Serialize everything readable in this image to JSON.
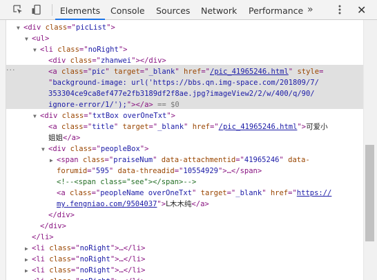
{
  "toolbar": {
    "tabs": [
      "Elements",
      "Console",
      "Sources",
      "Network",
      "Performance"
    ],
    "more_label": "»",
    "close_label": "✕"
  },
  "tree": {
    "lines": [
      {
        "indent": 1,
        "tri": "▼",
        "parts": [
          [
            "tag",
            "<div "
          ],
          [
            "an",
            "class"
          ],
          [
            "tag",
            "=\""
          ],
          [
            "av",
            "picList"
          ],
          [
            "tag",
            "\">"
          ]
        ]
      },
      {
        "indent": 2,
        "tri": "▼",
        "parts": [
          [
            "tag",
            "<ul>"
          ]
        ]
      },
      {
        "indent": 3,
        "tri": "▼",
        "parts": [
          [
            "tag",
            "<li "
          ],
          [
            "an",
            "class"
          ],
          [
            "tag",
            "=\""
          ],
          [
            "av",
            "noRight"
          ],
          [
            "tag",
            "\">"
          ]
        ]
      },
      {
        "indent": 4,
        "tri": "",
        "parts": [
          [
            "tag",
            "<div "
          ],
          [
            "an",
            "class"
          ],
          [
            "tag",
            "=\""
          ],
          [
            "av",
            "zhanwei"
          ],
          [
            "tag",
            "\"></div>"
          ]
        ]
      },
      {
        "indent": 4,
        "tri": "",
        "parts": [
          [
            "tag",
            "<a "
          ],
          [
            "an",
            "class"
          ],
          [
            "tag",
            "=\""
          ],
          [
            "av",
            "pic"
          ],
          [
            "tag",
            "\" "
          ],
          [
            "an",
            "target"
          ],
          [
            "tag",
            "=\""
          ],
          [
            "av",
            "_blank"
          ],
          [
            "tag",
            "\" "
          ],
          [
            "an",
            "href"
          ],
          [
            "tag",
            "=\""
          ],
          [
            "lnk",
            "/pic_41965246.html"
          ],
          [
            "tag",
            "\" "
          ],
          [
            "an",
            "style"
          ],
          [
            "tag",
            "="
          ]
        ]
      },
      {
        "indent": 4,
        "tri": "",
        "parts": [
          [
            "tag",
            "\""
          ],
          [
            "av",
            "background-image: url('https://bbs.qn.img-space.com/201809/7/"
          ]
        ]
      },
      {
        "indent": 4,
        "tri": "",
        "parts": [
          [
            "av",
            "353304ce9ca8ef477e2fb3189df2f8ae.jpg?imageView2/2/w/400/q/90/"
          ]
        ]
      },
      {
        "indent": 4,
        "tri": "",
        "parts": [
          [
            "av",
            "ignore-error/1/');"
          ],
          [
            "tag",
            "\"></a>"
          ],
          [
            "eq",
            " == $0"
          ]
        ]
      },
      {
        "indent": 3,
        "tri": "▼",
        "parts": [
          [
            "tag",
            "<div "
          ],
          [
            "an",
            "class"
          ],
          [
            "tag",
            "=\""
          ],
          [
            "av",
            "txtBox overOneTxt"
          ],
          [
            "tag",
            "\">"
          ]
        ]
      },
      {
        "indent": 4,
        "tri": "",
        "parts": [
          [
            "tag",
            "<a "
          ],
          [
            "an",
            "class"
          ],
          [
            "tag",
            "=\""
          ],
          [
            "av",
            "title"
          ],
          [
            "tag",
            "\" "
          ],
          [
            "an",
            "target"
          ],
          [
            "tag",
            "=\""
          ],
          [
            "av",
            "_blank"
          ],
          [
            "tag",
            "\" "
          ],
          [
            "an",
            "href"
          ],
          [
            "tag",
            "=\""
          ],
          [
            "lnk",
            "/pic_41965246.html"
          ],
          [
            "tag",
            "\">"
          ],
          [
            "txt",
            "可爱小"
          ]
        ]
      },
      {
        "indent": 4,
        "tri": "",
        "parts": [
          [
            "txt",
            "姐姐"
          ],
          [
            "tag",
            "</a>"
          ]
        ]
      },
      {
        "indent": 4,
        "tri": "▼",
        "parts": [
          [
            "tag",
            "<div "
          ],
          [
            "an",
            "class"
          ],
          [
            "tag",
            "=\""
          ],
          [
            "av",
            "peopleBox"
          ],
          [
            "tag",
            "\">"
          ]
        ]
      },
      {
        "indent": 5,
        "tri": "▶",
        "parts": [
          [
            "tag",
            "<span "
          ],
          [
            "an",
            "class"
          ],
          [
            "tag",
            "=\""
          ],
          [
            "av",
            "praiseNum"
          ],
          [
            "tag",
            "\" "
          ],
          [
            "an",
            "data-attachmentid"
          ],
          [
            "tag",
            "=\""
          ],
          [
            "av",
            "41965246"
          ],
          [
            "tag",
            "\" "
          ],
          [
            "an",
            "data-"
          ]
        ]
      },
      {
        "indent": 5,
        "tri": "",
        "parts": [
          [
            "an",
            "forumid"
          ],
          [
            "tag",
            "=\""
          ],
          [
            "av",
            "595"
          ],
          [
            "tag",
            "\" "
          ],
          [
            "an",
            "data-threadid"
          ],
          [
            "tag",
            "=\""
          ],
          [
            "av",
            "10554929"
          ],
          [
            "tag",
            "\">…</span>"
          ]
        ]
      },
      {
        "indent": 5,
        "tri": "",
        "parts": [
          [
            "cm",
            "<!--<span class=\"see\"></span>-->"
          ]
        ]
      },
      {
        "indent": 5,
        "tri": "",
        "parts": [
          [
            "tag",
            "<a "
          ],
          [
            "an",
            "class"
          ],
          [
            "tag",
            "=\""
          ],
          [
            "av",
            "peopleName overOneTxt"
          ],
          [
            "tag",
            "\" "
          ],
          [
            "an",
            "target"
          ],
          [
            "tag",
            "=\""
          ],
          [
            "av",
            "_blank"
          ],
          [
            "tag",
            "\" "
          ],
          [
            "an",
            "href"
          ],
          [
            "tag",
            "=\""
          ],
          [
            "lnk",
            "https://"
          ]
        ]
      },
      {
        "indent": 5,
        "tri": "",
        "parts": [
          [
            "lnk",
            "my.fengniao.com/9504037"
          ],
          [
            "tag",
            "\">"
          ],
          [
            "txt",
            "L木木纯"
          ],
          [
            "tag",
            "</a>"
          ]
        ]
      },
      {
        "indent": 4,
        "tri": "",
        "parts": [
          [
            "tag",
            "</div>"
          ]
        ]
      },
      {
        "indent": 3,
        "tri": "",
        "parts": [
          [
            "tag",
            "</div>"
          ]
        ]
      },
      {
        "indent": 2,
        "tri": "",
        "parts": [
          [
            "tag",
            "</li>"
          ]
        ]
      },
      {
        "indent": 2,
        "tri": "▶",
        "parts": [
          [
            "tag",
            "<li "
          ],
          [
            "an",
            "class"
          ],
          [
            "tag",
            "=\""
          ],
          [
            "av",
            "noRight"
          ],
          [
            "tag",
            "\">…</li>"
          ]
        ]
      },
      {
        "indent": 2,
        "tri": "▶",
        "parts": [
          [
            "tag",
            "<li "
          ],
          [
            "an",
            "class"
          ],
          [
            "tag",
            "=\""
          ],
          [
            "av",
            "noRight"
          ],
          [
            "tag",
            "\">…</li>"
          ]
        ]
      },
      {
        "indent": 2,
        "tri": "▶",
        "parts": [
          [
            "tag",
            "<li "
          ],
          [
            "an",
            "class"
          ],
          [
            "tag",
            "=\""
          ],
          [
            "av",
            "noRight"
          ],
          [
            "tag",
            "\">…</li>"
          ]
        ]
      },
      {
        "indent": 2,
        "tri": "▶",
        "parts": [
          [
            "tag",
            "<li "
          ],
          [
            "an",
            "class"
          ],
          [
            "tag",
            "=\""
          ],
          [
            "av",
            "noRight"
          ],
          [
            "tag",
            "\">…</li>"
          ]
        ]
      }
    ]
  }
}
